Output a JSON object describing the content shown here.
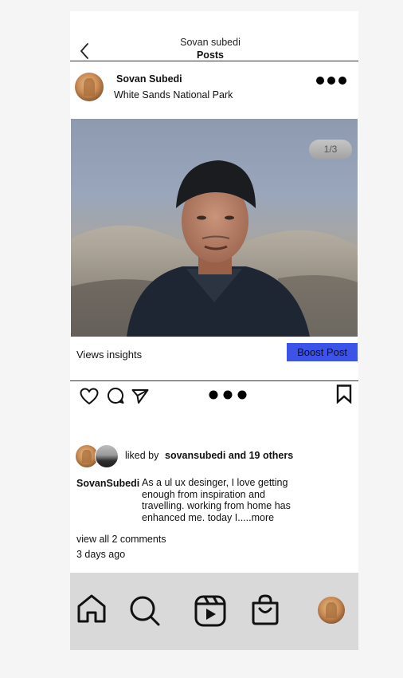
{
  "header": {
    "title": "Sovan subedi",
    "subtitle": "Posts"
  },
  "post": {
    "username": "Sovan Subedi",
    "location": "White Sands National Park",
    "image_counter": "1/3",
    "insights_label": "Views insights",
    "boost_label": "Boost Post"
  },
  "likes": {
    "prefix": "liked by",
    "names": "sovansubedi and 19 others"
  },
  "caption": {
    "user": "SovanSubedi",
    "text": "As a ul ux desinger, I love getting enough from inspiration and travelling. working from home has enhanced me. today I.....more"
  },
  "comments": {
    "view_all": "view all 2 comments",
    "time": "3 days ago"
  },
  "colors": {
    "boost": "#3d53e8",
    "tabbar": "#d9d9d9"
  },
  "icons": {
    "back": "chevron-left-icon",
    "more": "more-horizontal-icon",
    "like": "heart-icon",
    "comment": "comment-icon",
    "share": "send-icon",
    "save": "bookmark-icon",
    "home": "home-icon",
    "search": "search-icon",
    "reels": "reels-icon",
    "shop": "shopping-bag-icon"
  }
}
